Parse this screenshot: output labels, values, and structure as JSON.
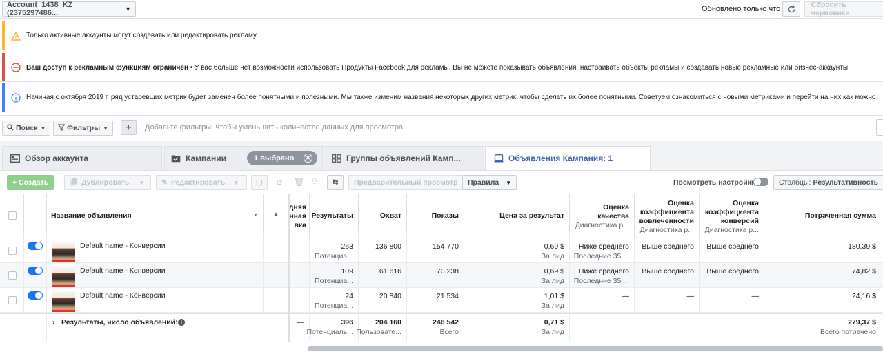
{
  "topbar": {
    "account": "Account_1438_KZ (2375297486...",
    "updated": "Обновлено только что",
    "reset": "Сбросить черновики"
  },
  "notices": {
    "warning": "Только активные аккаунты могут создавать или редактировать рекламу.",
    "error_bold": "Ваш доступ к рекламным функциям ограничен",
    "error_rest": " • У вас больше нет возможности использовать Продукты Facebook для рекламы. Вы не можете показывать объявления, настраивать объекты рекламы и создавать новые рекламные или бизнес-аккаунты.",
    "info": "Начиная с октября 2019 г. ряд устаревших метрик будет заменен более понятными и полезными. Мы также изменим названия некоторых других метрик, чтобы сделать их более понятными. Советуем ознакомиться с новыми метриками и перейти на них как можно"
  },
  "filterbar": {
    "search": "Поиск",
    "filters": "Фильтры",
    "plus": "+",
    "placeholder": "Добавьте фильтры, чтобы уменьшить количество данных для просмотра."
  },
  "tabs": {
    "overview": "Обзор аккаунта",
    "campaigns": "Кампании",
    "selected": "1 выбрано",
    "adsets": "Группы объявлений Камп...",
    "ads": "Объявления Кампания: 1"
  },
  "toolbar": {
    "create": "+ Создать",
    "duplicate": "Дублировать",
    "edit": "Редактировать",
    "preview": "Предварительный просмотр",
    "rules": "Правила",
    "view_settings": "Посмотреть настройки",
    "columns_label": "Столбцы:",
    "columns_value": "Результативность"
  },
  "table": {
    "headers": {
      "name": "Название объявления",
      "bid_1": "дняя",
      "bid_2": "енная",
      "bid_3": "вка",
      "results": "Результаты",
      "reach": "Охват",
      "impressions": "Показы",
      "cpr": "Цена за результат",
      "quality_1": "Оценка",
      "quality_2": "качества",
      "quality_sub": "Диагностика р...",
      "engagement_1": "Оценка",
      "engagement_2": "коэффициента",
      "engagement_3": "вовлеченности",
      "engagement_sub": "Диагностика р...",
      "conversion_1": "Оценка",
      "conversion_2": "коэффициента",
      "conversion_3": "конверсий",
      "conversion_sub": "Диагностика р...",
      "spent": "Потраченная сумма"
    },
    "rows": [
      {
        "name": "Default name - Конверсии",
        "results": "263",
        "results_sub": "Потенциа...",
        "reach": "136 800",
        "impressions": "154 770",
        "cpr": "0,69 $",
        "cpr_sub": "За лид",
        "quality": "Ниже среднего",
        "quality_sub": "Последние 35 ...",
        "engagement": "Выше среднего",
        "conversion": "Выше среднего",
        "spent": "180,39 $"
      },
      {
        "name": "Default name - Конверсии",
        "results": "109",
        "results_sub": "Потенциа...",
        "reach": "61 616",
        "impressions": "70 238",
        "cpr": "0,69 $",
        "cpr_sub": "За лид",
        "quality": "Ниже среднего",
        "quality_sub": "Последние 35 ...",
        "engagement": "Выше среднего",
        "conversion": "Выше среднего",
        "spent": "74,82 $"
      },
      {
        "name": "Default name - Конверсии",
        "results": "24",
        "results_sub": "Потенциа...",
        "reach": "20 840",
        "impressions": "21 534",
        "cpr": "1,01 $",
        "cpr_sub": "За лид",
        "quality": "—",
        "quality_sub": "",
        "engagement": "—",
        "conversion": "—",
        "spent": "24,16 $"
      }
    ],
    "total": {
      "label": "Результаты, число объявлений: 3",
      "bid": "—",
      "results": "396",
      "results_sub": "Потенциаль...",
      "reach": "204 160",
      "reach_sub": "Пользовате...",
      "impressions": "246 542",
      "impressions_sub": "Всего",
      "cpr": "0,71 $",
      "cpr_sub": "За лид",
      "spent": "279,37 $",
      "spent_sub": "Всего потрачено"
    }
  },
  "colors": {
    "warning": "#f7b928",
    "error": "#e24c4c",
    "info": "#4080ff",
    "toggle_on": "#1877f2",
    "create": "#8fd18c",
    "tab_active": "#4267b2"
  }
}
